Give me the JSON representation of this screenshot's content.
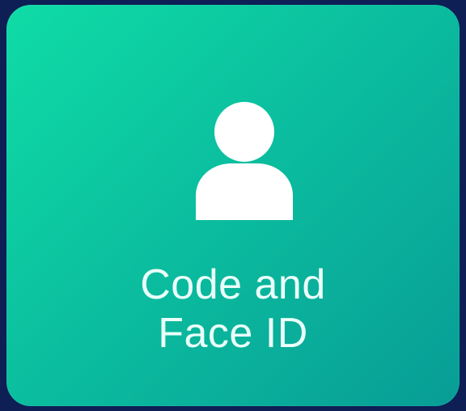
{
  "tile": {
    "label_line1": "Code and",
    "label_line2": "Face ID",
    "icon": "user-icon",
    "colors": {
      "background": "#0d1f55",
      "gradient_start": "#0fdca6",
      "gradient_end": "#089d96",
      "icon": "#ffffff",
      "text": "#eafffa"
    }
  }
}
